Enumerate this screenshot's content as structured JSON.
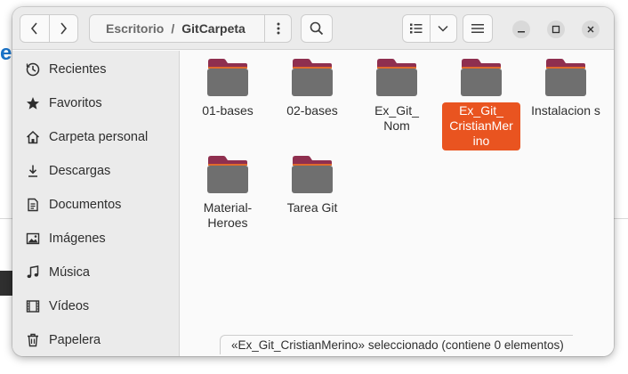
{
  "header": {
    "path": {
      "previous": "Escritorio",
      "separator": "/",
      "current": "GitCarpeta"
    }
  },
  "sidebar": {
    "items": [
      {
        "label": "Recientes",
        "icon": "clock-icon"
      },
      {
        "label": "Favoritos",
        "icon": "star-icon"
      },
      {
        "label": "Carpeta personal",
        "icon": "home-icon"
      },
      {
        "label": "Descargas",
        "icon": "download-icon"
      },
      {
        "label": "Documentos",
        "icon": "document-icon"
      },
      {
        "label": "Imágenes",
        "icon": "image-icon"
      },
      {
        "label": "Música",
        "icon": "music-icon"
      },
      {
        "label": "Vídeos",
        "icon": "video-icon"
      },
      {
        "label": "Papelera",
        "icon": "trash-icon"
      }
    ]
  },
  "content": {
    "folders": [
      {
        "label": "01-bases",
        "selected": false
      },
      {
        "label": "02-bases",
        "selected": false
      },
      {
        "label": "Ex_Git_ Nom",
        "selected": false
      },
      {
        "label": "Ex_Git_ CristianMer ino",
        "selected": true
      },
      {
        "label": "Instalacion s",
        "selected": false
      },
      {
        "label": "Material- Heroes",
        "selected": false
      },
      {
        "label": "Tarea Git",
        "selected": false
      }
    ]
  },
  "status": "«Ex_Git_CristianMerino» seleccionado  (contiene 0 elementos)",
  "colors": {
    "accent": "#e95420",
    "folder_body": "#6f6f6f",
    "folder_tab": "#8f2f4f"
  }
}
